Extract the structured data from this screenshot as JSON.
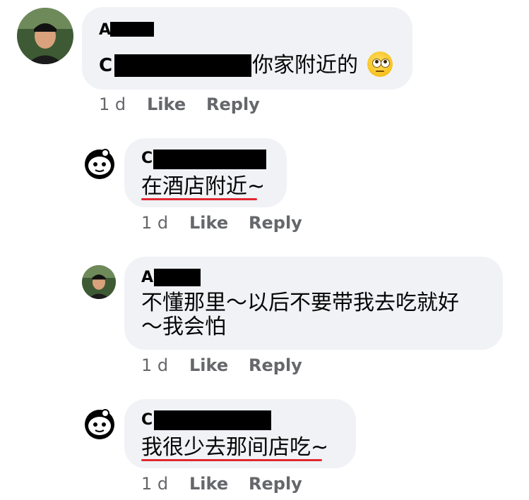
{
  "comments": [
    {
      "author_initial": "A",
      "text_prefix": "C",
      "text": "你家附近的",
      "emoji": "face-with-rolling-eyes",
      "time": "1 d",
      "like_label": "Like",
      "reply_label": "Reply"
    },
    {
      "author_initial": "C",
      "text": "在酒店附近~",
      "time": "1 d",
      "like_label": "Like",
      "reply_label": "Reply"
    },
    {
      "author_initial": "A",
      "text_line1": "不懂那里～以后不要带我去吃就好",
      "text_line2": "～我会怕",
      "time": "1 d",
      "like_label": "Like",
      "reply_label": "Reply"
    },
    {
      "author_initial": "C",
      "text": "我很少去那间店吃~",
      "time": "1 d",
      "like_label": "Like",
      "reply_label": "Reply"
    }
  ],
  "colors": {
    "bubble": "#f0f2f5",
    "meta": "#65676b",
    "spellcheck_underline": "#e0282f"
  }
}
